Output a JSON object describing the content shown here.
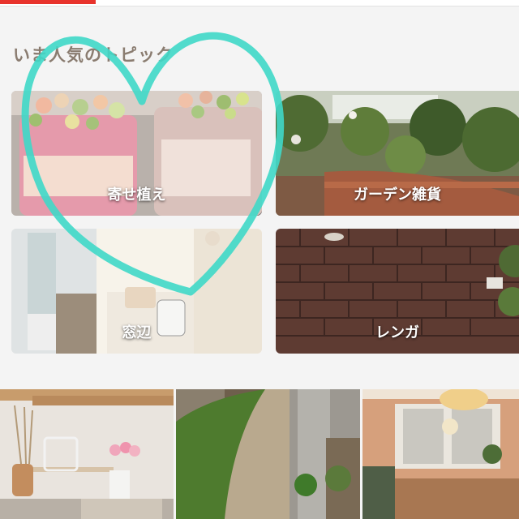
{
  "header": {
    "accent_color": "#e8332c"
  },
  "section": {
    "title": "いま人気のトピック"
  },
  "topics": [
    {
      "label": "寄せ植え"
    },
    {
      "label": "ガーデン雑貨"
    },
    {
      "label": "窓辺"
    },
    {
      "label": "レンガ"
    }
  ],
  "photos": [
    {
      "name": "interior-shelf-photo"
    },
    {
      "name": "garden-path-photo"
    },
    {
      "name": "room-pendant-photo"
    }
  ],
  "annotation": {
    "shape": "heart",
    "color": "#3fd8c8"
  }
}
